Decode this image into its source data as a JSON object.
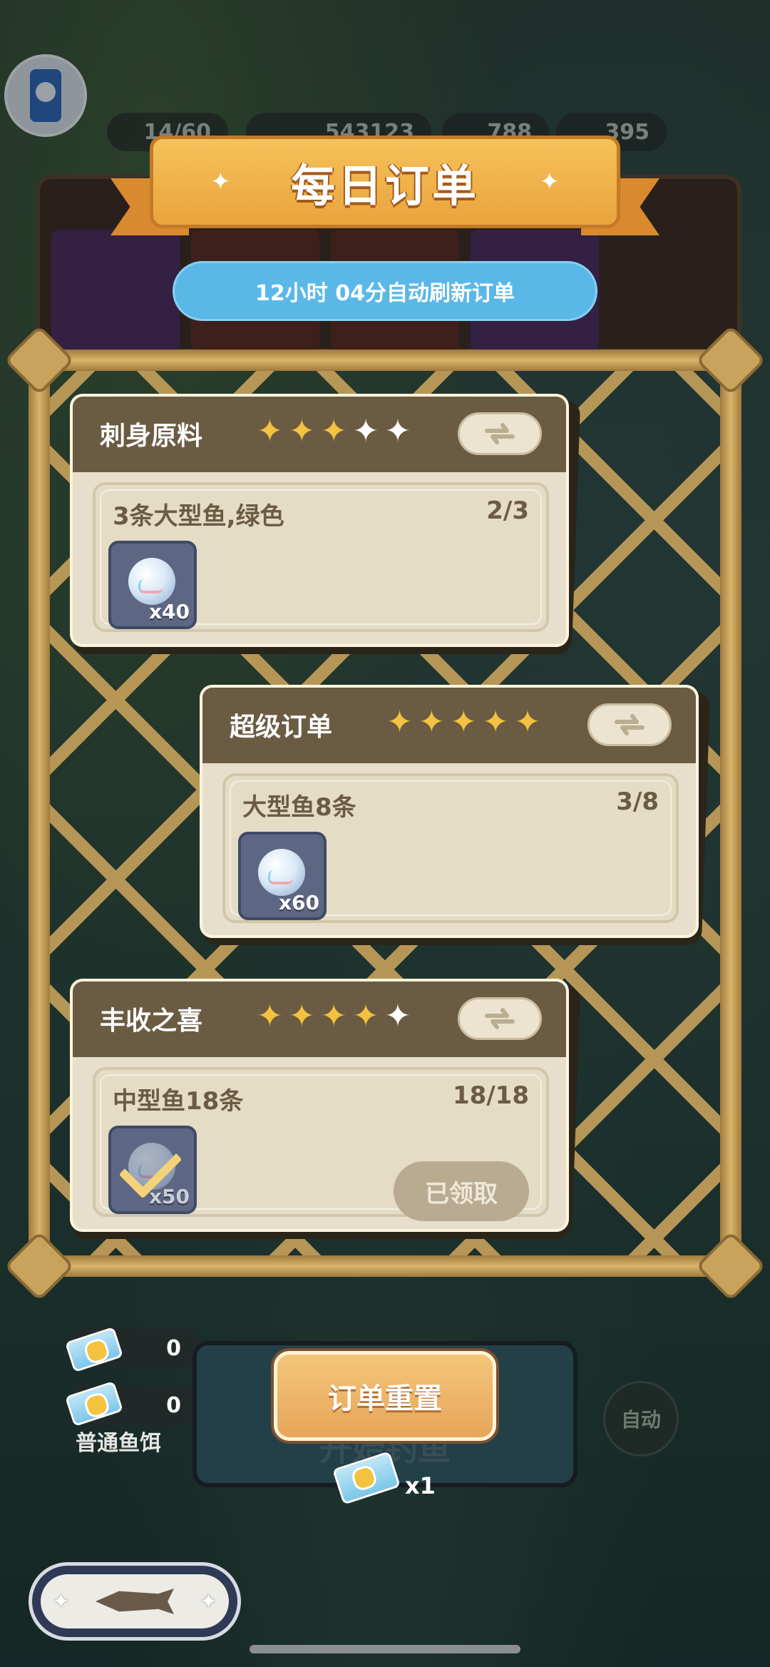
{
  "title": "每日订单",
  "refresh_notice": "12小时 04分自动刷新订单",
  "hud": {
    "left_count": "14/60",
    "middle_count": "543123",
    "coins": "788",
    "gems": "395"
  },
  "orders": [
    {
      "name": "刺身原料",
      "stars_filled": 3,
      "stars_total": 5,
      "task": "3条大型鱼,绿色",
      "progress": "2/3",
      "reward_qty": "x40",
      "claimed": false
    },
    {
      "name": "超级订单",
      "stars_filled": 5,
      "stars_total": 5,
      "task": "大型鱼8条",
      "progress": "3/8",
      "reward_qty": "x60",
      "claimed": false
    },
    {
      "name": "丰收之喜",
      "stars_filled": 4,
      "stars_total": 5,
      "task": "中型鱼18条",
      "progress": "18/18",
      "reward_qty": "x50",
      "claimed": true,
      "claimed_label": "已领取"
    }
  ],
  "bait": {
    "slot1_count": "0",
    "slot2_count": "0",
    "label": "普通鱼饵"
  },
  "reset_button": "订单重置",
  "reset_cost": "x1",
  "start_fishing_ghost": "开始钓鱼",
  "auto_button": "自动",
  "icons": {
    "device": "phone-icon",
    "swap": "swap-arrows-icon",
    "ticket": "ticket-icon",
    "pearl": "pearl-icon",
    "check": "check-icon",
    "star": "star-icon"
  },
  "colors": {
    "banner": "#eba33d",
    "refresh_pill": "#5ab8e8",
    "card_header": "#6b5b43",
    "star_on": "#f3c23f",
    "reset_button": "#e6a55a"
  }
}
